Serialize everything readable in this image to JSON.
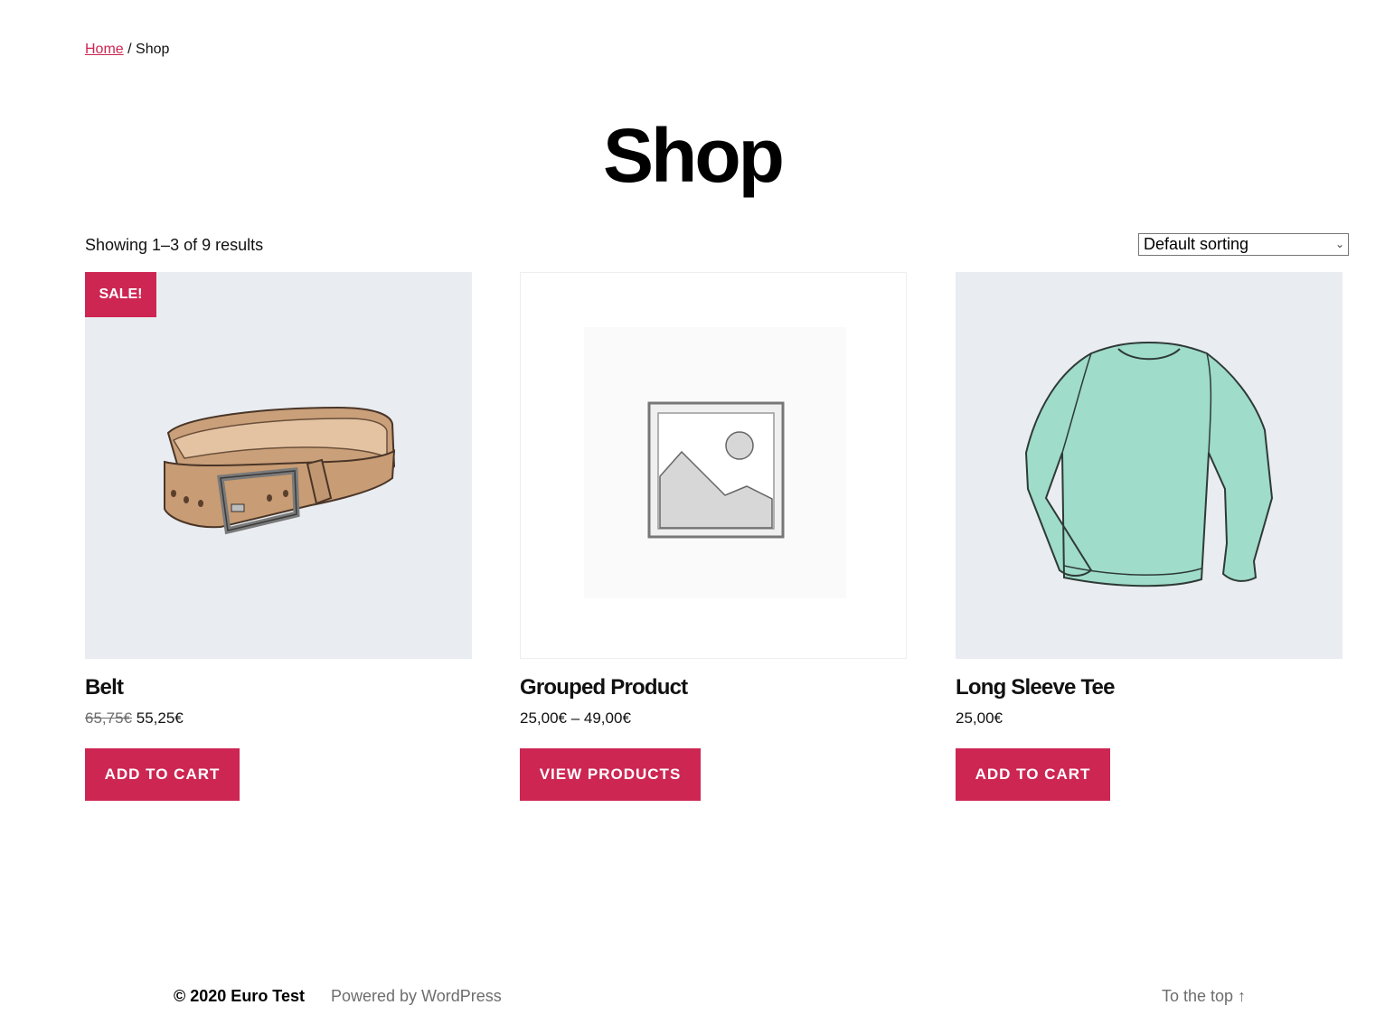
{
  "breadcrumb": {
    "home": "Home",
    "separator": " / ",
    "current": "Shop"
  },
  "page_title": "Shop",
  "result_count": "Showing 1–3 of 9 results",
  "sorting": {
    "selected": "Default sorting"
  },
  "products": [
    {
      "name": "Belt",
      "sale_badge": "SALE!",
      "price_old": "65,75€",
      "price": "55,25€",
      "button": "ADD TO CART",
      "image": "belt"
    },
    {
      "name": "Grouped Product",
      "price": "25,00€ – 49,00€",
      "button": "VIEW PRODUCTS",
      "image": "placeholder-image-icon"
    },
    {
      "name": "Long Sleeve Tee",
      "price": "25,00€",
      "button": "ADD TO CART",
      "image": "long-sleeve-tee"
    }
  ],
  "footer": {
    "copyright": "© 2020 Euro Test",
    "powered": "Powered by WordPress",
    "to_top": "To the top ↑"
  },
  "colors": {
    "accent": "#cd2653",
    "image_bg": "#e9edf1"
  }
}
